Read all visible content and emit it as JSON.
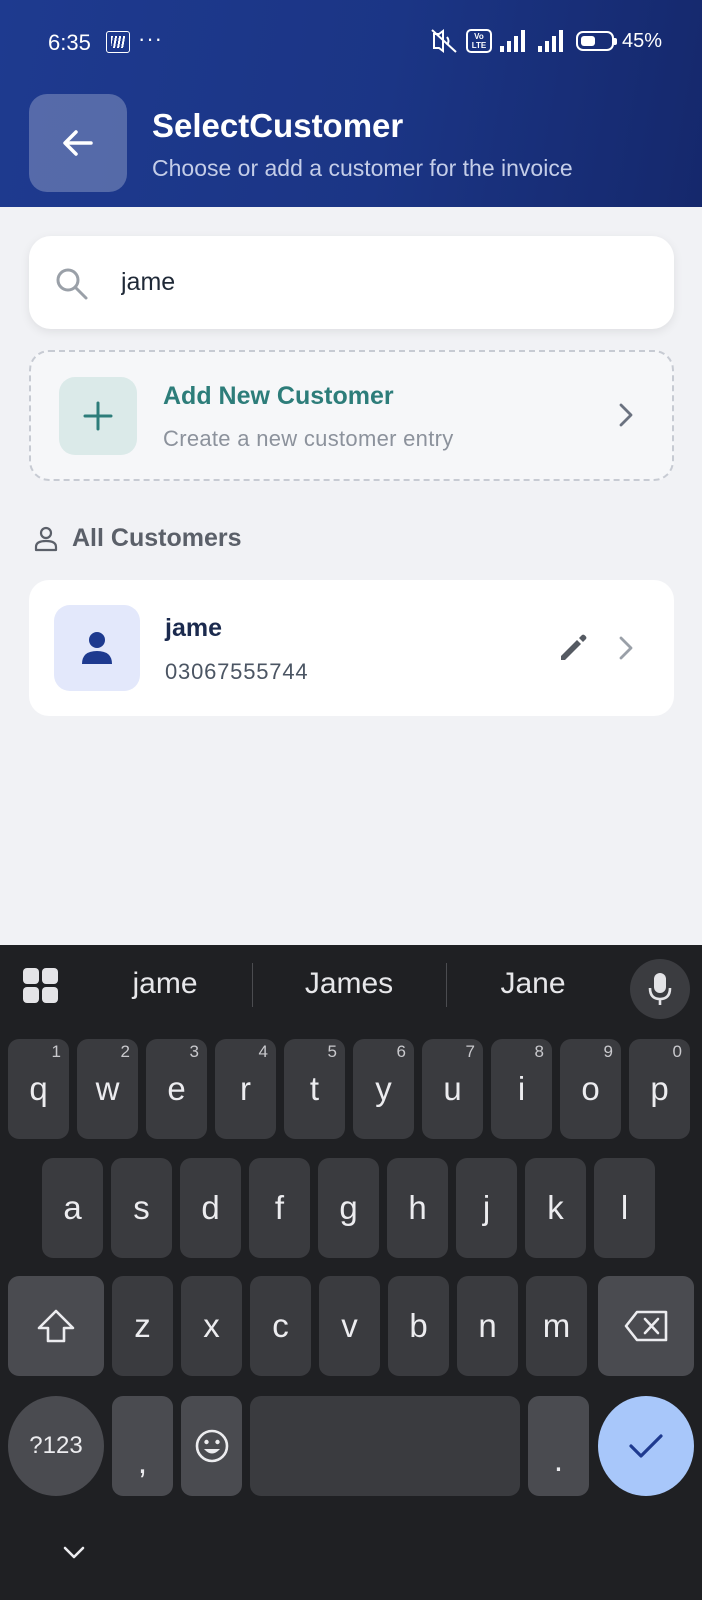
{
  "status_bar": {
    "time": "6:35",
    "dots": "···",
    "volte": "Vo\nLTE",
    "battery_pct": "45%",
    "icons": [
      "notification-icon",
      "mute-icon",
      "volte-icon",
      "signal-icon",
      "signal-icon",
      "battery-icon"
    ]
  },
  "header": {
    "title": "SelectCustomer",
    "subtitle": "Choose or add a customer for the invoice",
    "back_icon": "arrow-left-icon"
  },
  "search": {
    "value": "jame",
    "icon": "search-icon"
  },
  "add_customer": {
    "title": "Add New Customer",
    "subtitle": "Create a new customer entry",
    "icon": "plus-icon"
  },
  "section": {
    "label": "All Customers",
    "icon": "person-outline-icon"
  },
  "customers": [
    {
      "name": "jame",
      "phone": "03067555744"
    }
  ],
  "keyboard": {
    "suggestions": [
      "jame",
      "James",
      "Jane"
    ],
    "row1": [
      {
        "key": "q",
        "hint": "1"
      },
      {
        "key": "w",
        "hint": "2"
      },
      {
        "key": "e",
        "hint": "3"
      },
      {
        "key": "r",
        "hint": "4"
      },
      {
        "key": "t",
        "hint": "5"
      },
      {
        "key": "y",
        "hint": "6"
      },
      {
        "key": "u",
        "hint": "7"
      },
      {
        "key": "i",
        "hint": "8"
      },
      {
        "key": "o",
        "hint": "9"
      },
      {
        "key": "p",
        "hint": "0"
      }
    ],
    "row2": [
      "a",
      "s",
      "d",
      "f",
      "g",
      "h",
      "j",
      "k",
      "l"
    ],
    "row3": [
      "z",
      "x",
      "c",
      "v",
      "b",
      "n",
      "m"
    ],
    "symbols_label": "?123",
    "comma": ",",
    "period": "."
  },
  "colors": {
    "header_bg": "#1e3a8f",
    "accent_teal": "#2d7d7a",
    "enter_key": "#a8c7fa"
  }
}
